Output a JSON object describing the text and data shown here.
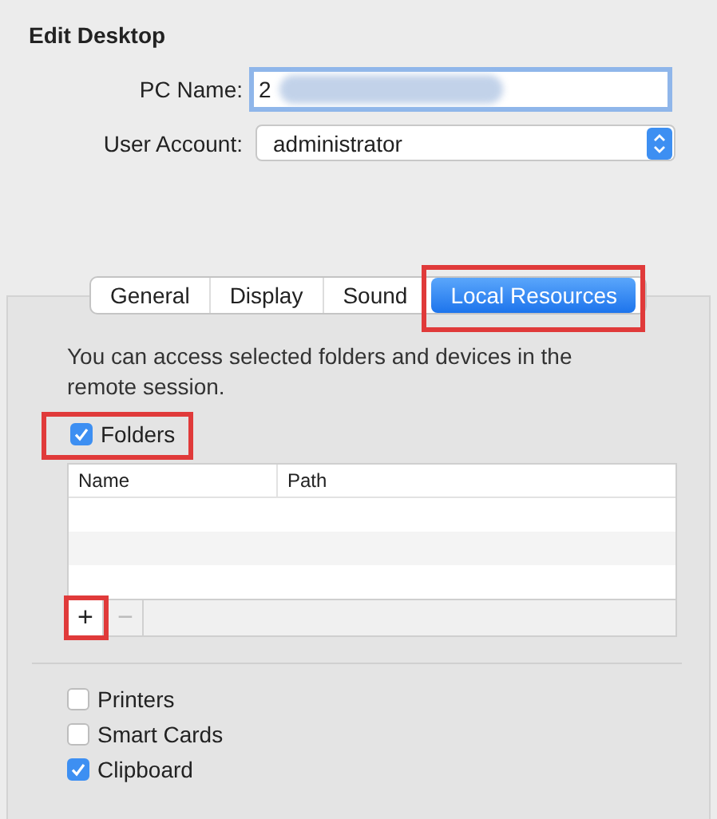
{
  "title": "Edit Desktop",
  "fields": [
    {
      "label": "PC Name:",
      "kind": "text",
      "value": "2",
      "redacted": true,
      "focused": true
    },
    {
      "label": "User Account:",
      "kind": "select",
      "value": "administrator",
      "focused": false
    }
  ],
  "tabs": [
    {
      "label": "General",
      "selected": false,
      "highlighted": false
    },
    {
      "label": "Display",
      "selected": false,
      "highlighted": false
    },
    {
      "label": "Sound",
      "selected": false,
      "highlighted": false
    },
    {
      "label": "Local Resources",
      "selected": true,
      "highlighted": true
    }
  ],
  "description": "You can access selected folders and devices in the remote session.",
  "folders": {
    "label": "Folders",
    "checked": true,
    "highlighted": true
  },
  "table": {
    "columns": [
      "Name",
      "Path"
    ]
  },
  "table_buttons": [
    {
      "label": "+",
      "disabled": false,
      "highlighted": true
    },
    {
      "label": "−",
      "disabled": true,
      "highlighted": false
    }
  ],
  "devices": [
    {
      "label": "Printers",
      "checked": false
    },
    {
      "label": "Smart Cards",
      "checked": false
    },
    {
      "label": "Clipboard",
      "checked": true
    }
  ]
}
